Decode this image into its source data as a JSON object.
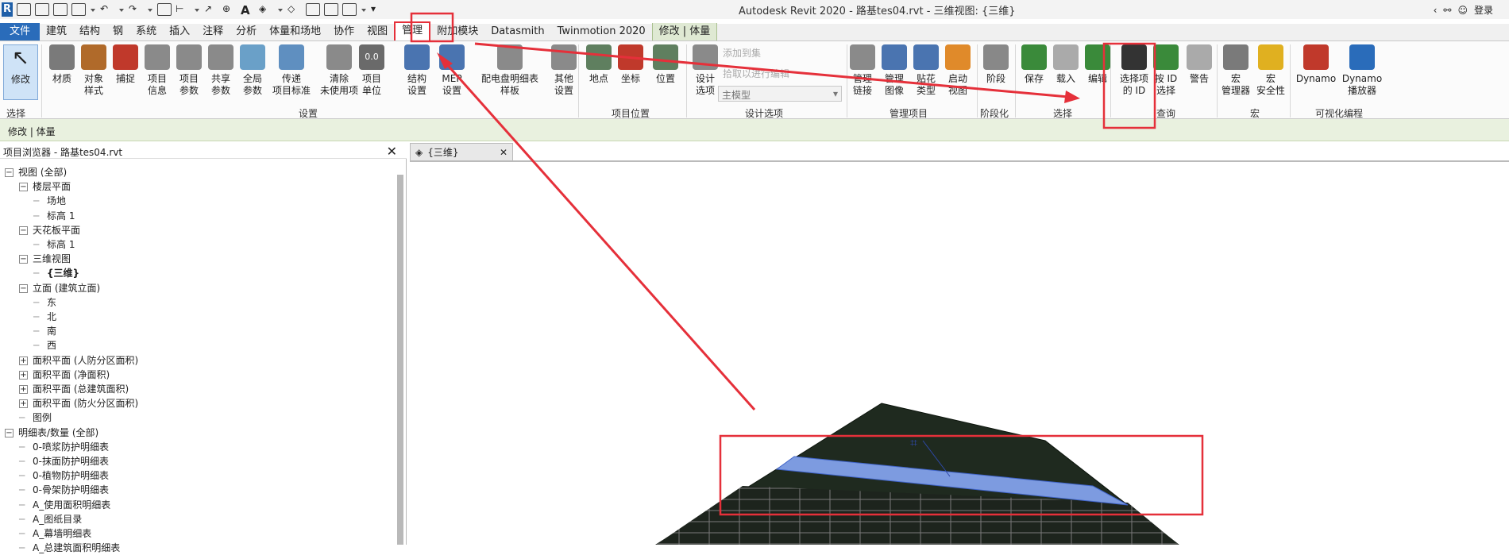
{
  "window": {
    "title": "Autodesk Revit 2020 - 路基tes04.rvt - 三维视图: {三维}",
    "signin_label": "登录"
  },
  "tabs": [
    {
      "label": "文件",
      "kind": "file"
    },
    {
      "label": "建筑"
    },
    {
      "label": "结构"
    },
    {
      "label": "钢"
    },
    {
      "label": "系统"
    },
    {
      "label": "插入"
    },
    {
      "label": "注释"
    },
    {
      "label": "分析"
    },
    {
      "label": "体量和场地"
    },
    {
      "label": "协作"
    },
    {
      "label": "视图"
    },
    {
      "label": "管理",
      "kind": "active"
    },
    {
      "label": "附加模块"
    },
    {
      "label": "Datasmith"
    },
    {
      "label": "Twinmotion 2020"
    },
    {
      "label": "修改 | 体量",
      "kind": "ctx"
    },
    {
      "label": "",
      "kind": "menu"
    }
  ],
  "ribbon": {
    "modify": {
      "label": "修改",
      "panel": "选择"
    },
    "settings_buttons": [
      {
        "l1": "材质",
        "l2": "",
        "icon": "materials-icon",
        "color": "#7a7a7a"
      },
      {
        "l1": "对象",
        "l2": "样式",
        "icon": "object-styles-icon",
        "color": "#b06a2a"
      },
      {
        "l1": "捕捉",
        "l2": "",
        "icon": "snaps-icon",
        "color": "#c0392b"
      },
      {
        "l1": "项目",
        "l2": "信息",
        "icon": "project-info-icon",
        "color": "#8a8a8a"
      },
      {
        "l1": "项目",
        "l2": "参数",
        "icon": "project-params-icon",
        "color": "#8a8a8a"
      },
      {
        "l1": "共享",
        "l2": "参数",
        "icon": "shared-params-icon",
        "color": "#8a8a8a"
      },
      {
        "l1": "全局",
        "l2": "参数",
        "icon": "global-params-icon",
        "color": "#6aa0c8"
      },
      {
        "l1": "传递",
        "l2": "项目标准",
        "icon": "transfer-standards-icon",
        "color": "#5f8fc0"
      },
      {
        "l1": "清除",
        "l2": "未使用项",
        "icon": "purge-icon",
        "color": "#8a8a8a"
      },
      {
        "l1": "项目",
        "l2": "单位",
        "icon": "project-units-icon",
        "color": "#6a6a6a",
        "glyph": "0.0"
      },
      {
        "l1": "结构",
        "l2": "设置",
        "icon": "structural-settings-icon",
        "color": "#4a74b0"
      },
      {
        "l1": "MEP",
        "l2": "设置",
        "icon": "mep-settings-icon",
        "color": "#4a74b0"
      },
      {
        "l1": "配电盘明细表",
        "l2": "样板",
        "icon": "panel-schedule-icon",
        "color": "#8a8a8a"
      },
      {
        "l1": "其他",
        "l2": "设置",
        "icon": "other-settings-icon",
        "color": "#8a8a8a"
      }
    ],
    "settings_panel": "设置",
    "location_buttons": [
      {
        "l1": "地点",
        "l2": "",
        "icon": "location-icon",
        "color": "#5f7f5f"
      },
      {
        "l1": "坐标",
        "l2": "",
        "icon": "coordinates-icon",
        "color": "#c0392b"
      },
      {
        "l1": "位置",
        "l2": "",
        "icon": "position-icon",
        "color": "#5f7f5f"
      }
    ],
    "location_panel": "项目位置",
    "design_options": {
      "button_l1": "设计",
      "button_l2": "选项",
      "add_to_set": "添加到集",
      "pick_to_edit": "拾取以进行编辑",
      "main_model": "主模型",
      "panel": "设计选项"
    },
    "manage_buttons": [
      {
        "l1": "管理",
        "l2": "链接",
        "icon": "manage-links-icon",
        "color": "#8a8a8a"
      },
      {
        "l1": "管理",
        "l2": "图像",
        "icon": "manage-images-icon",
        "color": "#4a74b0"
      },
      {
        "l1": "贴花",
        "l2": "类型",
        "icon": "decal-types-icon",
        "color": "#4a74b0"
      },
      {
        "l1": "启动",
        "l2": "视图",
        "icon": "starting-view-icon",
        "color": "#e08a2a"
      }
    ],
    "manage_panel": "管理项目",
    "phasing": {
      "l1": "阶段",
      "panel": "阶段化"
    },
    "selection_buttons": [
      {
        "l1": "保存",
        "icon": "save-selection-icon",
        "color": "#3a8a3a"
      },
      {
        "l1": "载入",
        "icon": "load-selection-icon",
        "color": "#aaaaaa"
      },
      {
        "l1": "编辑",
        "icon": "edit-selection-icon",
        "color": "#3a8a3a"
      }
    ],
    "selection_panel": "选择",
    "inquiry_buttons": [
      {
        "l1": "选择项",
        "l2": "的 ID",
        "icon": "ids-of-selection-icon",
        "color": "#333333"
      },
      {
        "l1": "按 ID",
        "l2": "选择",
        "icon": "select-by-id-icon",
        "color": "#3a8a3a"
      },
      {
        "l1": "警告",
        "l2": "",
        "icon": "warnings-icon",
        "color": "#aaaaaa"
      }
    ],
    "inquiry_panel": "查询",
    "macro_buttons": [
      {
        "l1": "宏",
        "l2": "管理器",
        "icon": "macro-manager-icon",
        "color": "#7a7a7a"
      },
      {
        "l1": "宏",
        "l2": "安全性",
        "icon": "macro-security-icon",
        "color": "#e0b020"
      }
    ],
    "macro_panel": "宏",
    "dynamo_buttons": [
      {
        "l1": "Dynamo",
        "l2": "",
        "icon": "dynamo-icon",
        "color": "#c0392b"
      },
      {
        "l1": "Dynamo",
        "l2": "播放器",
        "icon": "dynamo-player-icon",
        "color": "#2a6cba"
      }
    ],
    "dynamo_panel": "可视化编程"
  },
  "context_bar": "修改 | 体量",
  "project_browser": {
    "title": "项目浏览器 - 路基tes04.rvt",
    "items": [
      {
        "text": "视图 (全部)",
        "exp": "−",
        "level": 0
      },
      {
        "text": "楼层平面",
        "exp": "−",
        "level": 1
      },
      {
        "text": "场地",
        "level": 2
      },
      {
        "text": "标高 1",
        "level": 2
      },
      {
        "text": "天花板平面",
        "exp": "−",
        "level": 1
      },
      {
        "text": "标高 1",
        "level": 2
      },
      {
        "text": "三维视图",
        "exp": "−",
        "level": 1
      },
      {
        "text": "{三维}",
        "level": 2,
        "bold": true
      },
      {
        "text": "立面 (建筑立面)",
        "exp": "−",
        "level": 1
      },
      {
        "text": "东",
        "level": 2
      },
      {
        "text": "北",
        "level": 2
      },
      {
        "text": "南",
        "level": 2
      },
      {
        "text": "西",
        "level": 2
      },
      {
        "text": "面积平面 (人防分区面积)",
        "exp": "+",
        "level": 1
      },
      {
        "text": "面积平面 (净面积)",
        "exp": "+",
        "level": 1
      },
      {
        "text": "面积平面 (总建筑面积)",
        "exp": "+",
        "level": 1
      },
      {
        "text": "面积平面 (防火分区面积)",
        "exp": "+",
        "level": 1
      },
      {
        "text": "图例",
        "level": 1
      },
      {
        "text": "明细表/数量 (全部)",
        "exp": "−",
        "level": 0
      },
      {
        "text": "0-喷浆防护明细表",
        "level": 1
      },
      {
        "text": "0-抹面防护明细表",
        "level": 1
      },
      {
        "text": "0-植物防护明细表",
        "level": 1
      },
      {
        "text": "0-骨架防护明细表",
        "level": 1
      },
      {
        "text": "A_使用面积明细表",
        "level": 1
      },
      {
        "text": "A_图纸目录",
        "level": 1
      },
      {
        "text": "A_幕墙明细表",
        "level": 1
      },
      {
        "text": "A_总建筑面积明细表",
        "level": 1
      }
    ]
  },
  "view_tab": {
    "label": "{三维}"
  },
  "colors": {
    "annotation": "#e5303a",
    "file_tab": "#2a6cba",
    "context": "#e9f1df",
    "band": "#7d9be0",
    "terrain": "#1f2a1f"
  }
}
